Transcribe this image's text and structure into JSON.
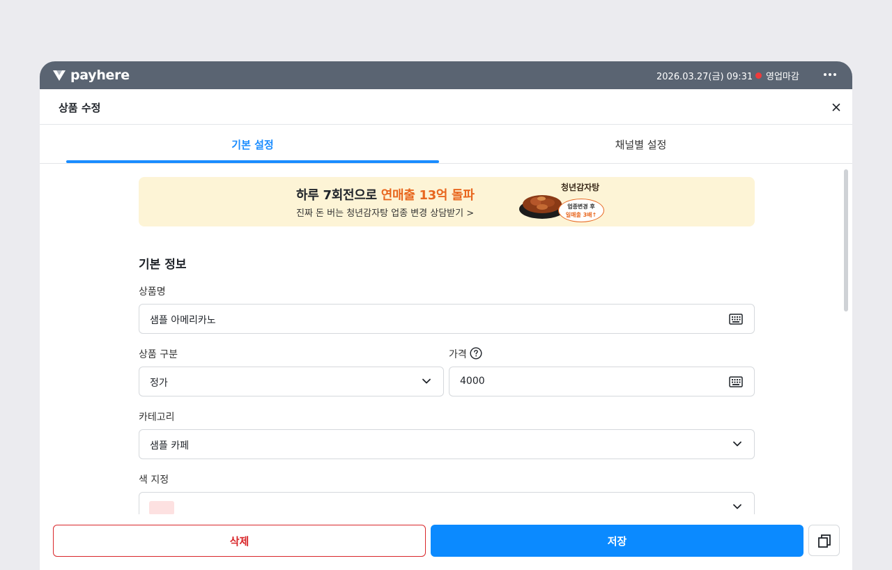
{
  "colors": {
    "accent": "#1a8cff",
    "save": "#0b8aff",
    "delete": "#d9262a",
    "status_closed": "#ef3b3b",
    "titlebar": "#5a6472",
    "banner_bg": "#fdf4d6",
    "banner_highlight": "#e8671f",
    "swatch": "#fde1e1"
  },
  "titlebar": {
    "brand": "payhere",
    "datetime": "2026.03.27(금) 09:31",
    "status": "영업마감",
    "more_icon": "more-horizontal-icon"
  },
  "header": {
    "title": "상품 수정",
    "close_icon": "close-icon"
  },
  "tabs": [
    {
      "label": "기본 설정",
      "active": true
    },
    {
      "label": "채널별 설정",
      "active": false
    }
  ],
  "banner": {
    "headline_prefix": "하루 7회전으로 ",
    "headline_highlight": "연매출 13억 돌파",
    "subtext": "진짜 돈 버는 청년감자탕 업종 변경 상담받기 >",
    "brand": "청년감자탕",
    "bubble_line1": "업종변경 후",
    "bubble_line2": "일매출 3배↑"
  },
  "form": {
    "section_title": "기본 정보",
    "product_name": {
      "label": "상품명",
      "value": "샘플 아메리카노",
      "icon": "keyboard-icon"
    },
    "product_type": {
      "label": "상품 구분",
      "value": "정가",
      "icon": "chevron-down-icon"
    },
    "price": {
      "label": "가격",
      "value": "4000",
      "icon": "keyboard-icon",
      "help_icon": "help-circle-icon"
    },
    "category": {
      "label": "카테고리",
      "value": "샘플 카페",
      "icon": "chevron-down-icon"
    },
    "color": {
      "label": "색 지정",
      "icon": "chevron-down-icon"
    }
  },
  "footer": {
    "delete_label": "삭제",
    "save_label": "저장",
    "copy_icon": "copy-icon"
  }
}
